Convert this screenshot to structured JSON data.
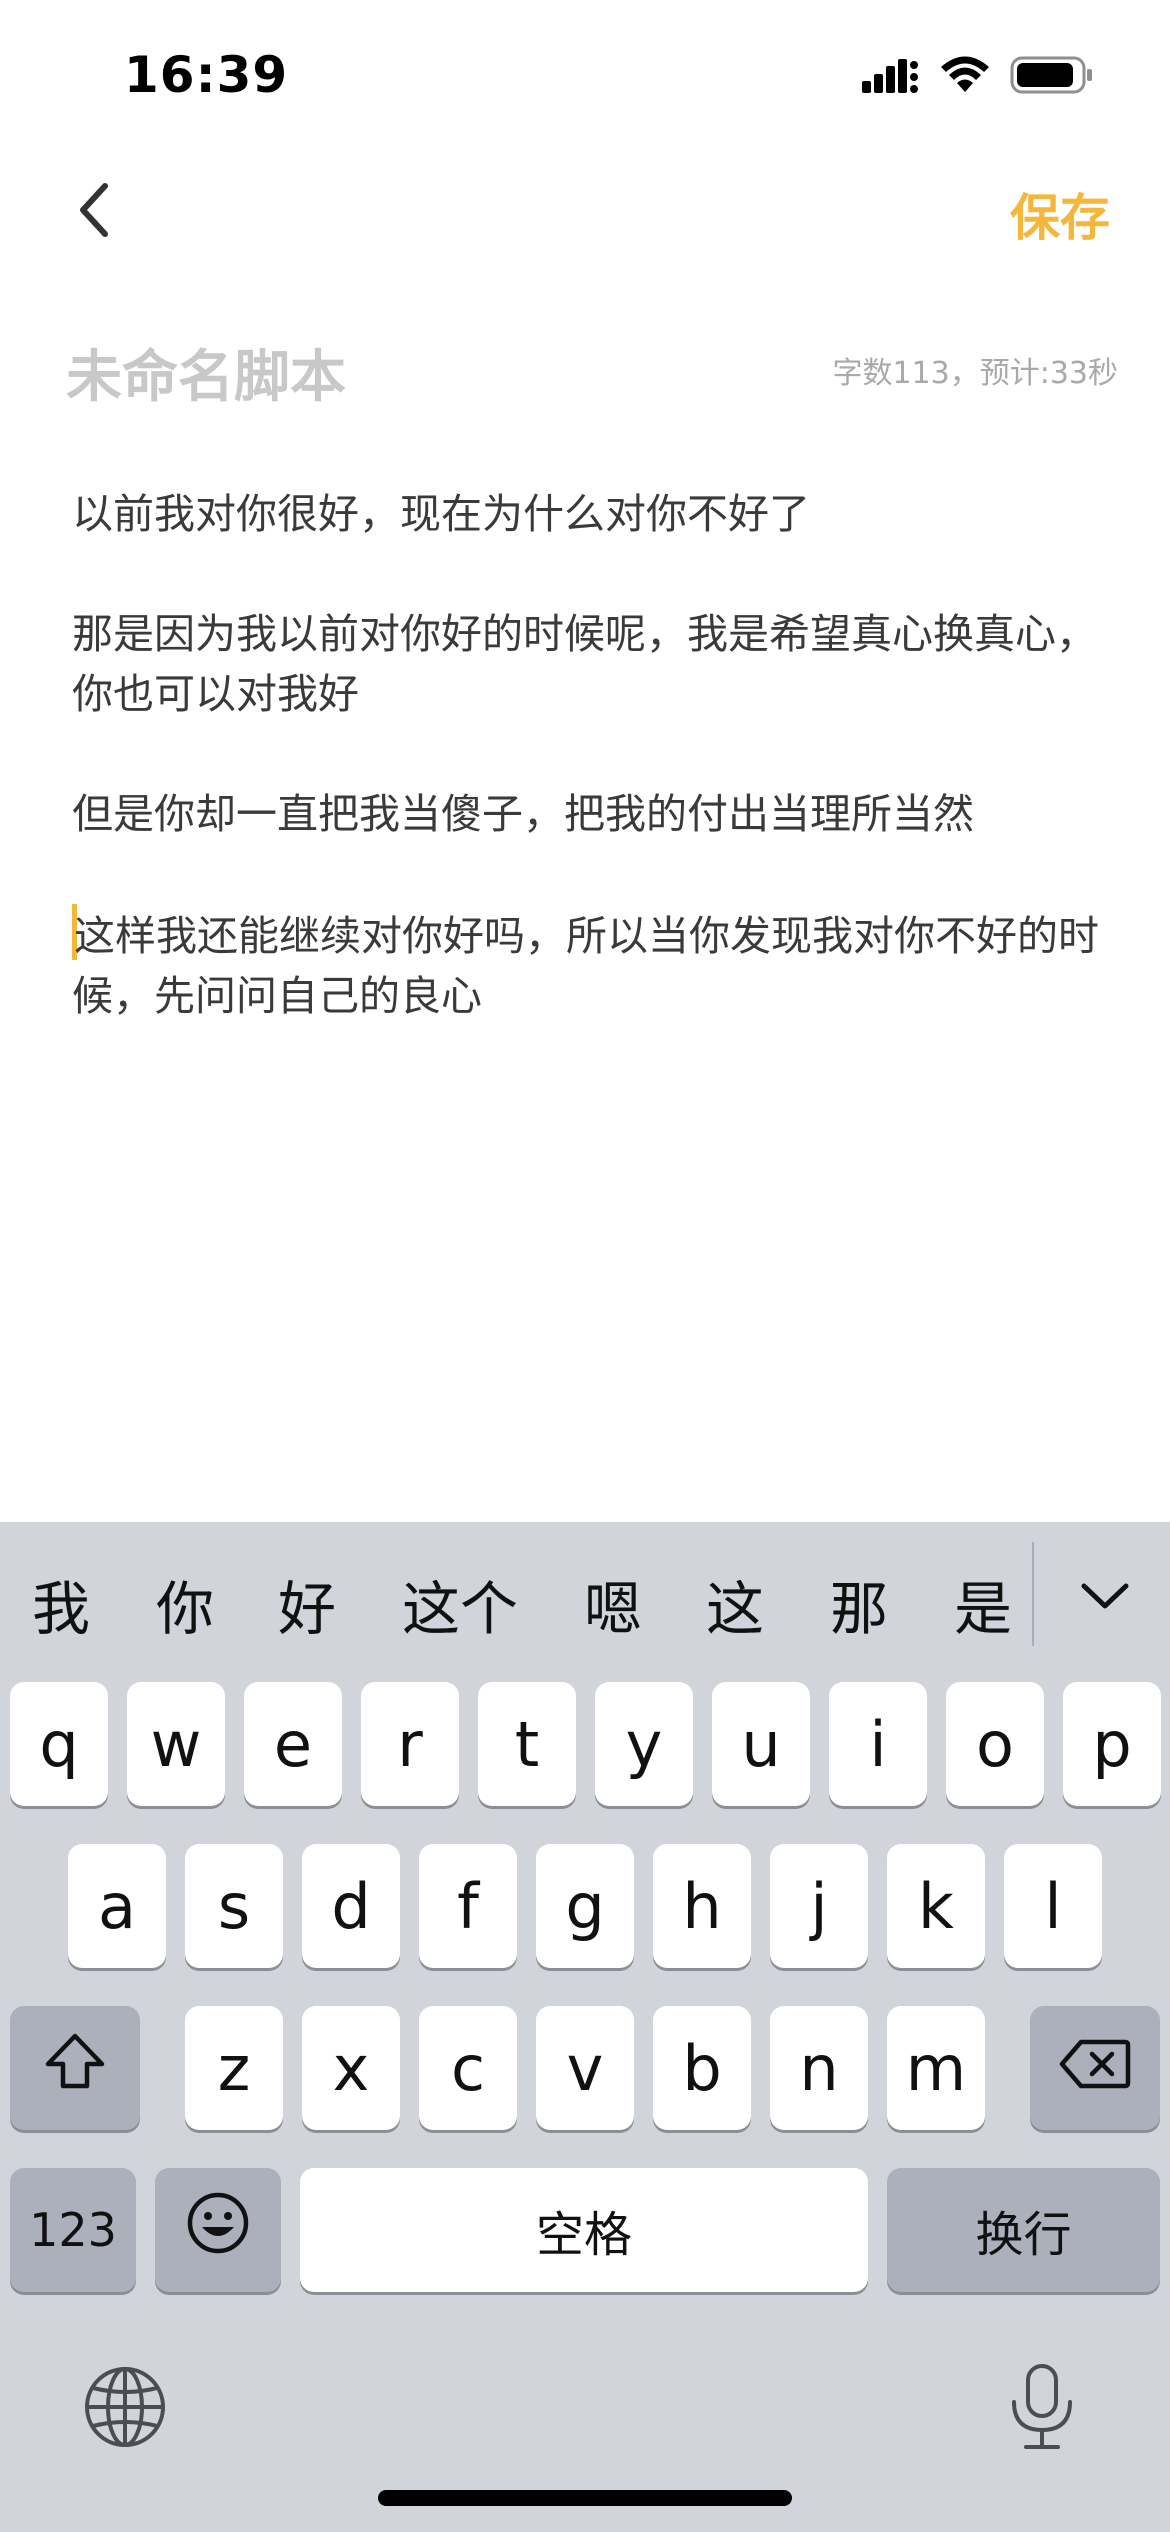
{
  "status_bar": {
    "time": "16:39"
  },
  "nav": {
    "save_label": "保存"
  },
  "editor": {
    "title_placeholder": "未命名脚本",
    "word_count": "字数113，预计:33秒",
    "paragraphs": [
      "以前我对你很好，现在为什么对你不好了",
      "那是因为我以前对你好的时候呢，我是希望真心换真心，你也可以对我好",
      "但是你却一直把我当傻子，把我的付出当理所当然",
      "这样我还能继续对你好吗，所以当你发现我对你不好的时候，先问问自己的良心"
    ],
    "caret_color": "#F5B73B"
  },
  "keyboard": {
    "candidates": [
      "我",
      "你",
      "好",
      "这个",
      "嗯",
      "这",
      "那",
      "是"
    ],
    "row1": [
      "q",
      "w",
      "e",
      "r",
      "t",
      "y",
      "u",
      "i",
      "o",
      "p"
    ],
    "row2": [
      "a",
      "s",
      "d",
      "f",
      "g",
      "h",
      "j",
      "k",
      "l"
    ],
    "row3": [
      "z",
      "x",
      "c",
      "v",
      "b",
      "n",
      "m"
    ],
    "numbers_label": "123",
    "space_label": "空格",
    "return_label": "换行",
    "icons": {
      "shift": "shift-icon",
      "delete": "delete-icon",
      "emoji": "emoji-icon",
      "globe": "globe-icon",
      "mic": "microphone-icon",
      "collapse": "chevron-down-icon"
    }
  },
  "colors": {
    "accent": "#F5B73B",
    "keyboard_bg": "#d1d4db",
    "dark_key": "#abb0ba"
  }
}
